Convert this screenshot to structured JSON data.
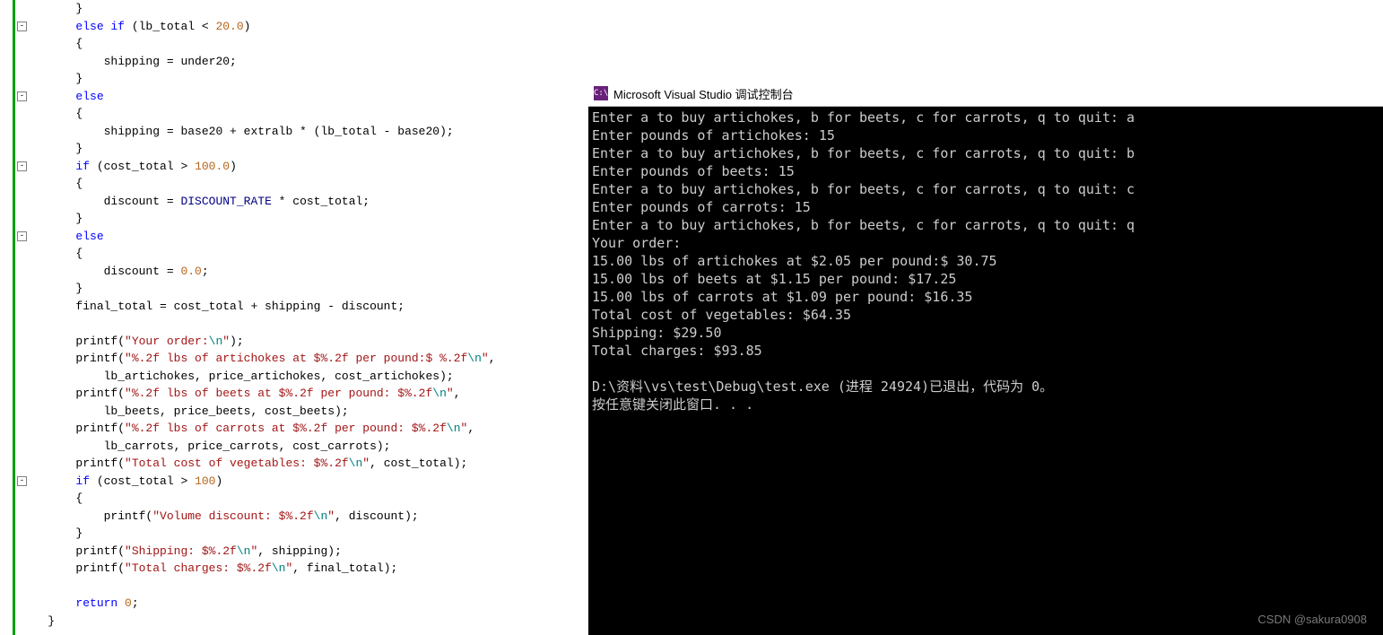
{
  "fold_markers": [
    {
      "line": 1,
      "glyph": "-"
    },
    {
      "line": 5,
      "glyph": "-"
    },
    {
      "line": 9,
      "glyph": "-"
    },
    {
      "line": 13,
      "glyph": "-"
    },
    {
      "line": 27,
      "glyph": "-"
    }
  ],
  "code": [
    {
      "indent": 2,
      "tokens": [
        {
          "t": "}",
          "c": "id"
        }
      ]
    },
    {
      "indent": 2,
      "tokens": [
        {
          "t": "else if",
          "c": "kw"
        },
        {
          "t": " (lb_total < ",
          "c": "id"
        },
        {
          "t": "20.0",
          "c": "num"
        },
        {
          "t": ")",
          "c": "id"
        }
      ]
    },
    {
      "indent": 2,
      "tokens": [
        {
          "t": "{",
          "c": "id"
        }
      ]
    },
    {
      "indent": 3,
      "tokens": [
        {
          "t": "shipping = under20;",
          "c": "id"
        }
      ]
    },
    {
      "indent": 2,
      "tokens": [
        {
          "t": "}",
          "c": "id"
        }
      ]
    },
    {
      "indent": 2,
      "tokens": [
        {
          "t": "else",
          "c": "kw"
        }
      ]
    },
    {
      "indent": 2,
      "tokens": [
        {
          "t": "{",
          "c": "id"
        }
      ]
    },
    {
      "indent": 3,
      "tokens": [
        {
          "t": "shipping = base20 + extralb * (lb_total - base20);",
          "c": "id"
        }
      ]
    },
    {
      "indent": 2,
      "tokens": [
        {
          "t": "}",
          "c": "id"
        }
      ]
    },
    {
      "indent": 2,
      "tokens": [
        {
          "t": "if",
          "c": "kw"
        },
        {
          "t": " (cost_total > ",
          "c": "id"
        },
        {
          "t": "100.0",
          "c": "num"
        },
        {
          "t": ")",
          "c": "id"
        }
      ]
    },
    {
      "indent": 2,
      "tokens": [
        {
          "t": "{",
          "c": "id"
        }
      ]
    },
    {
      "indent": 3,
      "tokens": [
        {
          "t": "discount = ",
          "c": "id"
        },
        {
          "t": "DISCOUNT_RATE",
          "c": "cmp"
        },
        {
          "t": " * cost_total;",
          "c": "id"
        }
      ]
    },
    {
      "indent": 2,
      "tokens": [
        {
          "t": "}",
          "c": "id"
        }
      ]
    },
    {
      "indent": 2,
      "tokens": [
        {
          "t": "else",
          "c": "kw"
        }
      ]
    },
    {
      "indent": 2,
      "tokens": [
        {
          "t": "{",
          "c": "id"
        }
      ]
    },
    {
      "indent": 3,
      "tokens": [
        {
          "t": "discount = ",
          "c": "id"
        },
        {
          "t": "0.0",
          "c": "num"
        },
        {
          "t": ";",
          "c": "id"
        }
      ]
    },
    {
      "indent": 2,
      "tokens": [
        {
          "t": "}",
          "c": "id"
        }
      ]
    },
    {
      "indent": 2,
      "tokens": [
        {
          "t": "final_total = cost_total + shipping - discount;",
          "c": "id"
        }
      ]
    },
    {
      "indent": 2,
      "tokens": []
    },
    {
      "indent": 2,
      "tokens": [
        {
          "t": "printf(",
          "c": "id"
        },
        {
          "t": "\"Your order:",
          "c": "str"
        },
        {
          "t": "\\n",
          "c": "esc"
        },
        {
          "t": "\"",
          "c": "str"
        },
        {
          "t": ");",
          "c": "id"
        }
      ]
    },
    {
      "indent": 2,
      "tokens": [
        {
          "t": "printf(",
          "c": "id"
        },
        {
          "t": "\"%.2f lbs of artichokes at $%.2f per pound:$ %.2f",
          "c": "str"
        },
        {
          "t": "\\n",
          "c": "esc"
        },
        {
          "t": "\"",
          "c": "str"
        },
        {
          "t": ",",
          "c": "id"
        }
      ]
    },
    {
      "indent": 3,
      "tokens": [
        {
          "t": "lb_artichokes, price_artichokes, cost_artichokes);",
          "c": "id"
        }
      ]
    },
    {
      "indent": 2,
      "tokens": [
        {
          "t": "printf(",
          "c": "id"
        },
        {
          "t": "\"%.2f lbs of beets at $%.2f per pound: $%.2f",
          "c": "str"
        },
        {
          "t": "\\n",
          "c": "esc"
        },
        {
          "t": "\"",
          "c": "str"
        },
        {
          "t": ",",
          "c": "id"
        }
      ]
    },
    {
      "indent": 3,
      "tokens": [
        {
          "t": "lb_beets, price_beets, cost_beets);",
          "c": "id"
        }
      ]
    },
    {
      "indent": 2,
      "tokens": [
        {
          "t": "printf(",
          "c": "id"
        },
        {
          "t": "\"%.2f lbs of carrots at $%.2f per pound: $%.2f",
          "c": "str"
        },
        {
          "t": "\\n",
          "c": "esc"
        },
        {
          "t": "\"",
          "c": "str"
        },
        {
          "t": ",",
          "c": "id"
        }
      ]
    },
    {
      "indent": 3,
      "tokens": [
        {
          "t": "lb_carrots, price_carrots, cost_carrots);",
          "c": "id"
        }
      ]
    },
    {
      "indent": 2,
      "tokens": [
        {
          "t": "printf(",
          "c": "id"
        },
        {
          "t": "\"Total cost of vegetables: $%.2f",
          "c": "str"
        },
        {
          "t": "\\n",
          "c": "esc"
        },
        {
          "t": "\"",
          "c": "str"
        },
        {
          "t": ", cost_total);",
          "c": "id"
        }
      ]
    },
    {
      "indent": 2,
      "tokens": [
        {
          "t": "if",
          "c": "kw"
        },
        {
          "t": " (cost_total > ",
          "c": "id"
        },
        {
          "t": "100",
          "c": "num"
        },
        {
          "t": ")",
          "c": "id"
        }
      ]
    },
    {
      "indent": 2,
      "tokens": [
        {
          "t": "{",
          "c": "id"
        }
      ]
    },
    {
      "indent": 3,
      "tokens": [
        {
          "t": "printf(",
          "c": "id"
        },
        {
          "t": "\"Volume discount: $%.2f",
          "c": "str"
        },
        {
          "t": "\\n",
          "c": "esc"
        },
        {
          "t": "\"",
          "c": "str"
        },
        {
          "t": ", discount);",
          "c": "id"
        }
      ]
    },
    {
      "indent": 2,
      "tokens": [
        {
          "t": "}",
          "c": "id"
        }
      ]
    },
    {
      "indent": 2,
      "tokens": [
        {
          "t": "printf(",
          "c": "id"
        },
        {
          "t": "\"Shipping: $%.2f",
          "c": "str"
        },
        {
          "t": "\\n",
          "c": "esc"
        },
        {
          "t": "\"",
          "c": "str"
        },
        {
          "t": ", shipping);",
          "c": "id"
        }
      ]
    },
    {
      "indent": 2,
      "tokens": [
        {
          "t": "printf(",
          "c": "id"
        },
        {
          "t": "\"Total charges: $%.2f",
          "c": "str"
        },
        {
          "t": "\\n",
          "c": "esc"
        },
        {
          "t": "\"",
          "c": "str"
        },
        {
          "t": ", final_total);",
          "c": "id"
        }
      ]
    },
    {
      "indent": 2,
      "tokens": []
    },
    {
      "indent": 2,
      "tokens": [
        {
          "t": "return",
          "c": "kw"
        },
        {
          "t": " ",
          "c": "id"
        },
        {
          "t": "0",
          "c": "num"
        },
        {
          "t": ";",
          "c": "id"
        }
      ]
    },
    {
      "indent": 1,
      "tokens": [
        {
          "t": "}",
          "c": "id"
        }
      ]
    }
  ],
  "console": {
    "title": "Microsoft Visual Studio 调试控制台",
    "icon_text": "C:\\",
    "lines": [
      "Enter a to buy artichokes, b for beets, c for carrots, q to quit: a",
      "Enter pounds of artichokes: 15",
      "Enter a to buy artichokes, b for beets, c for carrots, q to quit: b",
      "Enter pounds of beets: 15",
      "Enter a to buy artichokes, b for beets, c for carrots, q to quit: c",
      "Enter pounds of carrots: 15",
      "Enter a to buy artichokes, b for beets, c for carrots, q to quit: q",
      "Your order:",
      "15.00 lbs of artichokes at $2.05 per pound:$ 30.75",
      "15.00 lbs of beets at $1.15 per pound: $17.25",
      "15.00 lbs of carrots at $1.09 per pound: $16.35",
      "Total cost of vegetables: $64.35",
      "Shipping: $29.50",
      "Total charges: $93.85",
      "",
      "D:\\资料\\vs\\test\\Debug\\test.exe (进程 24924)已退出，代码为 0。",
      "按任意键关闭此窗口. . ."
    ]
  },
  "watermark": "CSDN @sakura0908"
}
